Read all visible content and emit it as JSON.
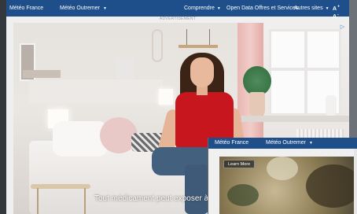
{
  "topbar": {
    "brand": "Météo France",
    "outremer": "Météo Outremer",
    "comprendre": "Comprendre",
    "opendata": "Open Data Offres et Services",
    "autres": "Autres sites",
    "font_size_label_big": "A",
    "font_size_label_small": "A",
    "font_size_plus": "+",
    "font_size_minus": "-",
    "chevron": "▼"
  },
  "ad": {
    "label": "ADVERTISEMENT",
    "choices_icon": "adchoices-icon",
    "subtitle": "Tout médicament peut exposer à des risques, pa"
  },
  "overlay": {
    "brand": "Météo France",
    "outremer": "Météo Outremer",
    "chevron": "▼",
    "learn_more": "Learn More"
  },
  "colors": {
    "nav_blue": "#1f4f8a",
    "shirt_red": "#c8161e"
  }
}
